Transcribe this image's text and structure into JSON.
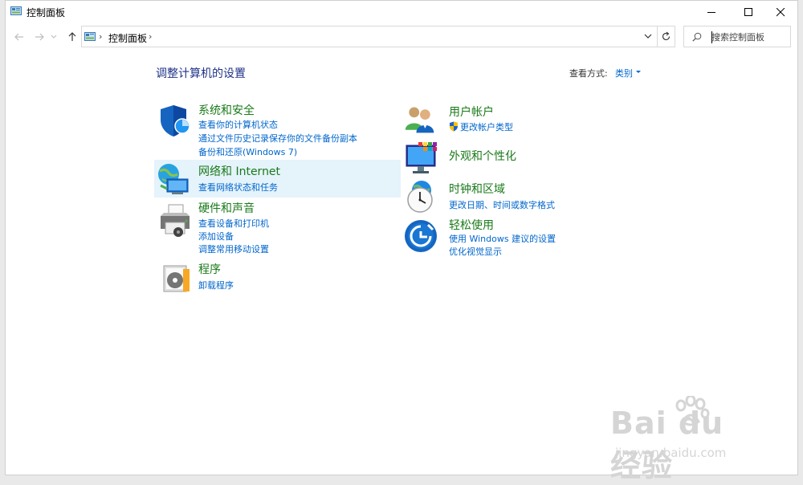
{
  "window": {
    "title": "控制面板"
  },
  "address": {
    "path": "控制面板"
  },
  "search": {
    "placeholder": "搜索控制面板"
  },
  "main": {
    "heading": "调整计算机的设置",
    "view_by_label": "查看方式:",
    "view_by_value": "类别"
  },
  "categories_left": [
    {
      "title": "系统和安全",
      "icon": "shield-icon",
      "links": [
        "查看你的计算机状态",
        "通过文件历史记录保存你的文件备份副本",
        "备份和还原(Windows 7)"
      ]
    },
    {
      "title": "网络和 Internet",
      "icon": "network-icon",
      "links": [
        "查看网络状态和任务"
      ]
    },
    {
      "title": "硬件和声音",
      "icon": "printer-icon",
      "links": [
        "查看设备和打印机",
        "添加设备",
        "调整常用移动设置"
      ]
    },
    {
      "title": "程序",
      "icon": "programs-icon",
      "links": [
        "卸载程序"
      ]
    }
  ],
  "categories_right": [
    {
      "title": "用户帐户",
      "icon": "users-icon",
      "links": [
        "更改帐户类型"
      ]
    },
    {
      "title": "外观和个性化",
      "icon": "appearance-icon",
      "links": []
    },
    {
      "title": "时钟和区域",
      "icon": "clock-icon",
      "links": [
        "更改日期、时间或数字格式"
      ]
    },
    {
      "title": "轻松使用",
      "icon": "ease-of-access-icon",
      "links": [
        "使用 Windows 建议的设置",
        "优化视觉显示"
      ]
    }
  ],
  "watermark": {
    "brand": "Bai du 经验",
    "site": "jingyan.baidu.com"
  },
  "colors": {
    "link": "#0066cc",
    "category_title": "#1a7a1a",
    "heading": "#1e3287",
    "hover": "#e5f3fb"
  }
}
